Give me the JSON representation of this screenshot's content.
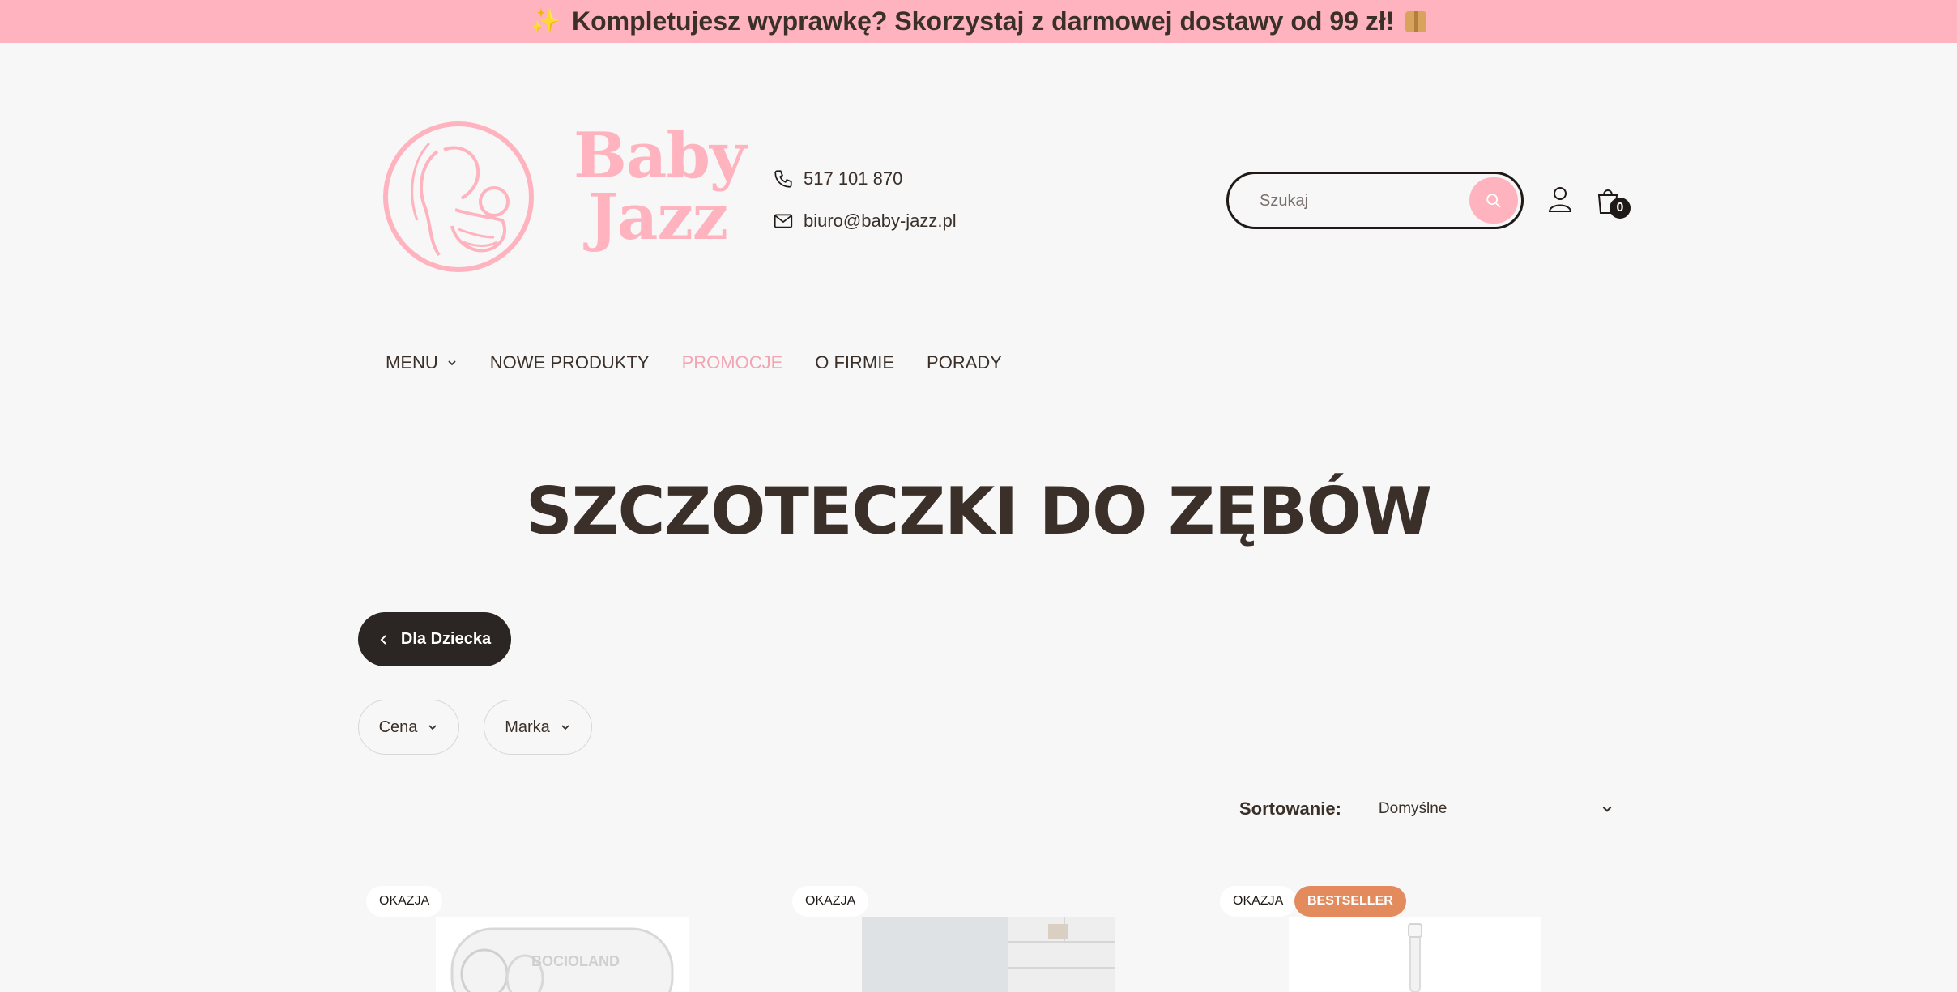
{
  "promo_bar": {
    "text": "Kompletujesz wyprawkę? Skorzystaj z darmowej dostawy od 99 zł!"
  },
  "brand": {
    "line1": "Baby",
    "line2": "Jazz",
    "color": "#ffb3bf"
  },
  "contact": {
    "phone": "517 101 870",
    "email": "biuro@baby-jazz.pl"
  },
  "search": {
    "placeholder": "Szukaj"
  },
  "cart": {
    "count": "0"
  },
  "nav": {
    "menu": "MENU",
    "new": "NOWE PRODUKTY",
    "promo": "PROMOCJE",
    "about": "O FIRMIE",
    "tips": "PORADY"
  },
  "page": {
    "title": "SZCZOTECZKI DO ZĘBÓW"
  },
  "back_button": {
    "label": "Dla Dziecka"
  },
  "filters": {
    "price": "Cena",
    "brand": "Marka"
  },
  "sorting": {
    "label": "Sortowanie:",
    "value": "Domyślne"
  },
  "products": [
    {
      "badges": [
        "OKAZJA"
      ],
      "image_text": "BOCIOLAND"
    },
    {
      "badges": [
        "OKAZJA"
      ]
    },
    {
      "badges": [
        "OKAZJA",
        "BESTSELLER"
      ]
    }
  ],
  "colors": {
    "accent": "#ffb3bf",
    "dark": "#2b2623",
    "bestseller": "#e38b5c",
    "text": "#3a3029"
  }
}
